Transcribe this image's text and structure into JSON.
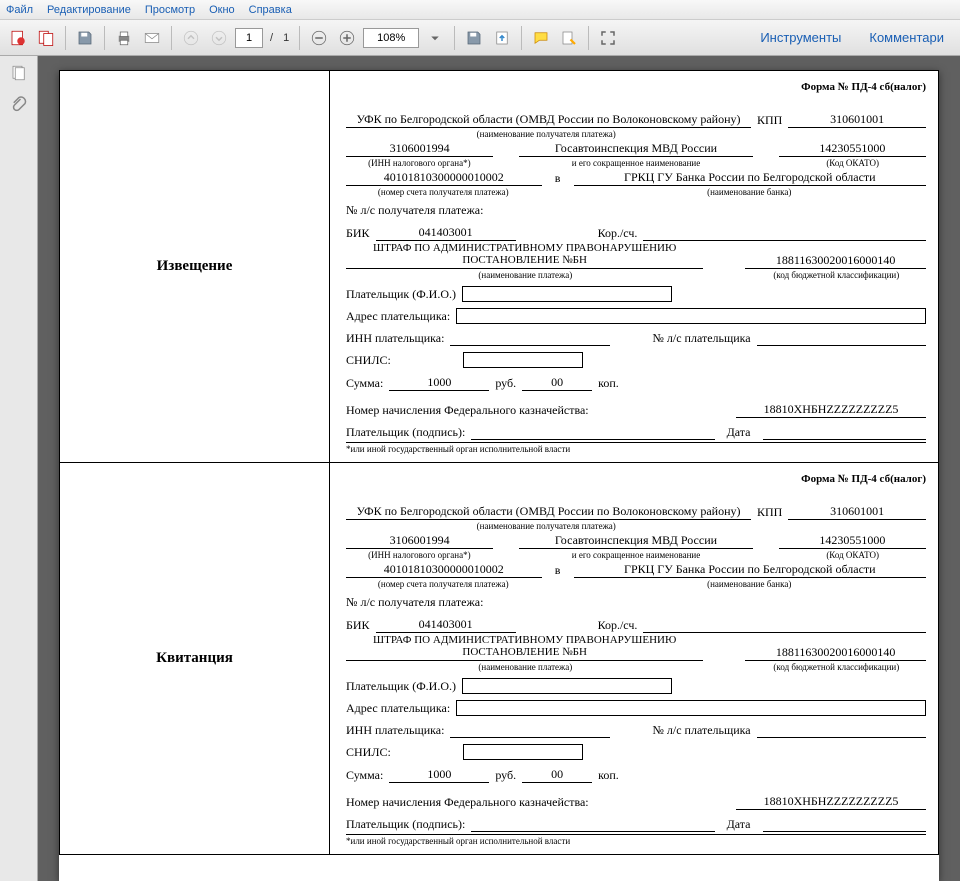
{
  "menu": {
    "file": "Файл",
    "edit": "Редактирование",
    "view": "Просмотр",
    "window": "Окно",
    "help": "Справка"
  },
  "toolbar": {
    "page_current": "1",
    "page_sep": "/",
    "page_total": "1",
    "zoom": "108%",
    "tools": "Инструменты",
    "comments": "Комментари"
  },
  "doc": {
    "section1_title": "Извещение",
    "section2_title": "Квитанция",
    "form_no": "Форма № ПД-4 сб(налог)",
    "recipient": "УФК по Белгородской области (ОМВД России по Волоконовскому району)",
    "recipient_sub": "(наименование получателя платежа)",
    "kpp_label": "КПП",
    "kpp": "310601001",
    "inn": "3106001994",
    "inn_sub": "(ИНН налогового органа*)",
    "gai": "Госавтоинспекция МВД России",
    "gai_sub": "и его сокращенное наименование",
    "okato": "14230551000",
    "okato_sub": "(Код ОКАТО)",
    "account": "40101810300000010002",
    "account_sub": "(номер счета получателя платежа)",
    "in_label": "в",
    "bank": "ГРКЦ ГУ Банка России по Белгородской области",
    "bank_sub": "(наименование банка)",
    "ls_label": "№ л/с получателя платежа:",
    "bik_label": "БИК",
    "bik": "041403001",
    "kor_label": "Кор./сч.",
    "payment_name": "ШТРАФ ПО АДМИНИСТРАТИВНОМУ ПРАВОНАРУШЕНИЮ ПОСТАНОВЛЕНИЕ №БН",
    "payment_sub": "(наименование платежа)",
    "kbk": "18811630020016000140",
    "kbk_sub": "(код бюджетной классификации)",
    "payer_fio": "Плательщик (Ф.И.О.)",
    "payer_addr": "Адрес плательщика:",
    "payer_inn": "ИНН плательщика:",
    "payer_ls": "№ л/с плательщика",
    "snils": "СНИЛС:",
    "sum_label": "Сумма:",
    "sum_rub": "1000",
    "rub_label": "руб.",
    "sum_kop": "00",
    "kop_label": "коп.",
    "treasury_no_label": "Номер начисления Федерального казначейства:",
    "treasury_no": "18810ХНБНZZZZZZZZZ5",
    "sign_label": "Плательщик (подпись):",
    "date_label": "Дата",
    "footnote": "*или иной государственный орган исполнительной власти"
  }
}
